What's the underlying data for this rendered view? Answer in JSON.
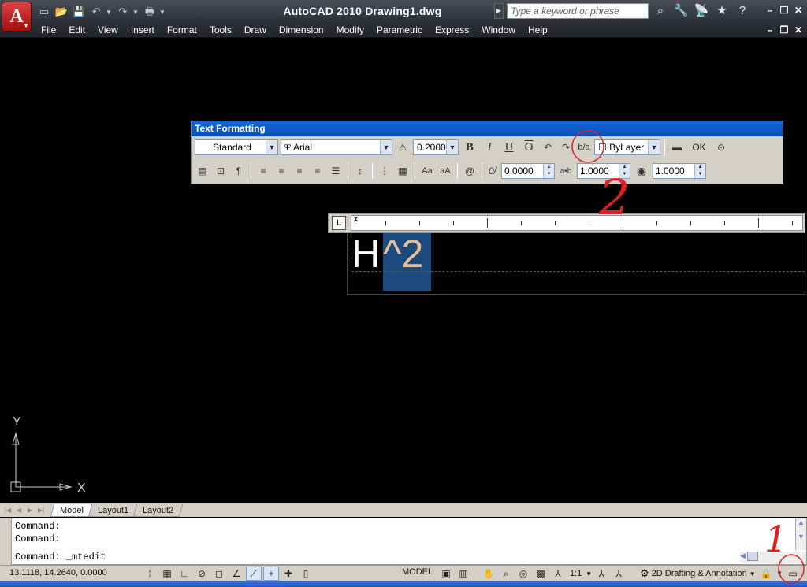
{
  "window": {
    "title": "AutoCAD 2010    Drawing1.dwg",
    "search_placeholder": "Type a keyword or phrase"
  },
  "menu": [
    "File",
    "Edit",
    "View",
    "Insert",
    "Format",
    "Tools",
    "Draw",
    "Dimension",
    "Modify",
    "Parametric",
    "Express",
    "Window",
    "Help"
  ],
  "text_formatting": {
    "title": "Text Formatting",
    "style": "Standard",
    "font": "Arial",
    "height": "0.2000",
    "bold": "B",
    "italic": "I",
    "underline": "U",
    "overline": "O",
    "color": "ByLayer",
    "ok": "OK",
    "oblique": "0.0000",
    "tracking": "1.0000",
    "width_factor": "1.0000",
    "case_upper": "Aa",
    "case_lower": "aA",
    "symbol": "@",
    "oblique_icon": "0/",
    "tracking_icon": "a•b"
  },
  "mtext": {
    "plain": "H",
    "selected": "^2"
  },
  "ruler": {
    "corner": "L"
  },
  "ucs": {
    "x_label": "X",
    "y_label": "Y"
  },
  "layout_tabs": [
    "Model",
    "Layout1",
    "Layout2"
  ],
  "command": {
    "line1": "Command:",
    "line2": "Command:",
    "line3": "Command:  _mtedit"
  },
  "status": {
    "coords": "13.1118, 14.2640, 0.0000",
    "model": "MODEL",
    "annotation_scale": "1:1",
    "workspace": "2D Drafting & Annotation"
  },
  "annotations": {
    "mark1": "1",
    "mark2": "2",
    "color": "#e02020"
  },
  "colors": {
    "titlebar": "#2b2f35",
    "panel": "#d4d0c8",
    "selection": "#1c4a7c",
    "selected_text": "#e8bf96"
  }
}
